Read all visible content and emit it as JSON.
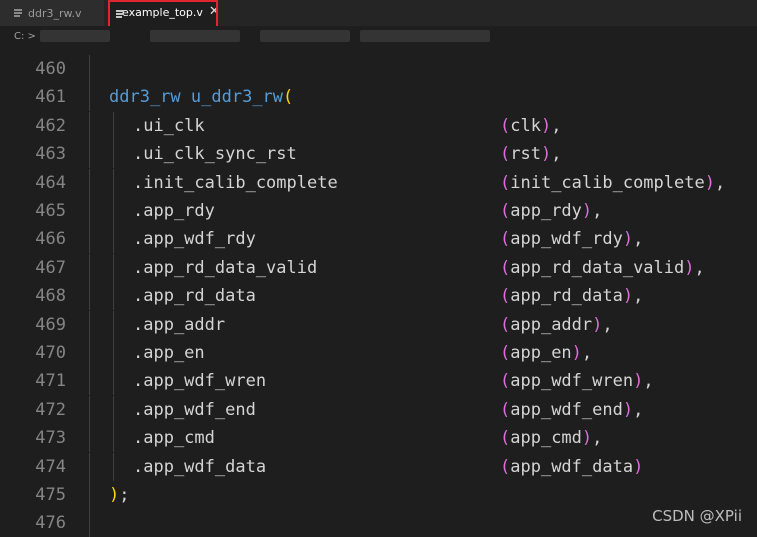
{
  "tabs": [
    {
      "label": "ddr3_rw.v",
      "active": false
    },
    {
      "label": "example_top.v",
      "active": true
    }
  ],
  "breadcrumb": {
    "prefix": "C: >"
  },
  "editor": {
    "lines": [
      {
        "num": "460",
        "kind": "blank"
      },
      {
        "num": "461",
        "kind": "inst",
        "module": "ddr3_rw",
        "inst": "u_ddr3_rw",
        "open": "("
      },
      {
        "num": "462",
        "kind": "port",
        "port": ".ui_clk",
        "sig": "clk",
        "end": ","
      },
      {
        "num": "463",
        "kind": "port",
        "port": ".ui_clk_sync_rst",
        "sig": "rst",
        "end": ","
      },
      {
        "num": "464",
        "kind": "port",
        "port": ".init_calib_complete",
        "sig": "init_calib_complete",
        "end": ","
      },
      {
        "num": "465",
        "kind": "port",
        "port": ".app_rdy",
        "sig": "app_rdy",
        "end": ","
      },
      {
        "num": "466",
        "kind": "port",
        "port": ".app_wdf_rdy",
        "sig": "app_wdf_rdy",
        "end": ","
      },
      {
        "num": "467",
        "kind": "port",
        "port": ".app_rd_data_valid",
        "sig": "app_rd_data_valid",
        "end": ","
      },
      {
        "num": "468",
        "kind": "port",
        "port": ".app_rd_data",
        "sig": "app_rd_data",
        "end": ","
      },
      {
        "num": "469",
        "kind": "port",
        "port": ".app_addr",
        "sig": "app_addr",
        "end": ","
      },
      {
        "num": "470",
        "kind": "port",
        "port": ".app_en",
        "sig": "app_en",
        "end": ","
      },
      {
        "num": "471",
        "kind": "port",
        "port": ".app_wdf_wren",
        "sig": "app_wdf_wren",
        "end": ","
      },
      {
        "num": "472",
        "kind": "port",
        "port": ".app_wdf_end",
        "sig": "app_wdf_end",
        "end": ","
      },
      {
        "num": "473",
        "kind": "port",
        "port": ".app_cmd",
        "sig": "app_cmd",
        "end": ","
      },
      {
        "num": "474",
        "kind": "port",
        "port": ".app_wdf_data",
        "sig": "app_wdf_data",
        "end": ""
      },
      {
        "num": "475",
        "kind": "close",
        "text": ");"
      },
      {
        "num": "476",
        "kind": "blank"
      }
    ]
  },
  "watermark": "CSDN @XPii",
  "colors": {
    "keyword": "#569cd6",
    "paren": "#da70d6",
    "brace": "#ffd700",
    "active_tab_outline": "#e0262c"
  }
}
